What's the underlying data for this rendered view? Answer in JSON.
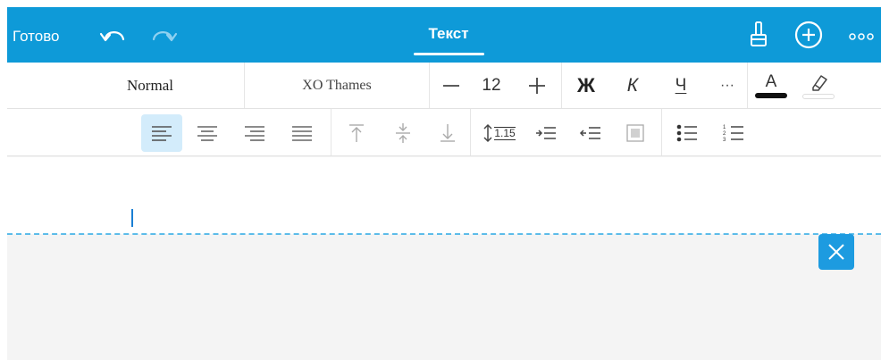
{
  "topbar": {
    "done_label": "Готово",
    "active_tab_label": "Текст",
    "icons": [
      "undo-icon",
      "redo-icon",
      "brush-icon",
      "add-icon",
      "more-icon"
    ]
  },
  "format": {
    "style_name": "Normal",
    "font_name": "XO Thames",
    "font_size": "12",
    "bold_label": "Ж",
    "italic_label": "К",
    "underline_label": "Ч",
    "more_label": "···",
    "font_color_label": "A"
  },
  "paragraph": {
    "line_spacing_value": "1.15",
    "alignment_selected": "left",
    "icons": [
      "align-left-icon",
      "align-center-icon",
      "align-right-icon",
      "align-justify-icon",
      "valign-top-icon",
      "valign-middle-icon",
      "valign-bottom-icon",
      "line-spacing-icon",
      "indent-increase-icon",
      "indent-decrease-icon",
      "text-box-icon",
      "bullet-list-icon",
      "numbered-list-icon"
    ]
  },
  "colors": {
    "topbar": "#0e9ad8",
    "selected_align": "#d3ecfb",
    "page_boundary": "#5cbce9",
    "close_button": "#1d9be0",
    "font_color_bar": "#111111"
  }
}
